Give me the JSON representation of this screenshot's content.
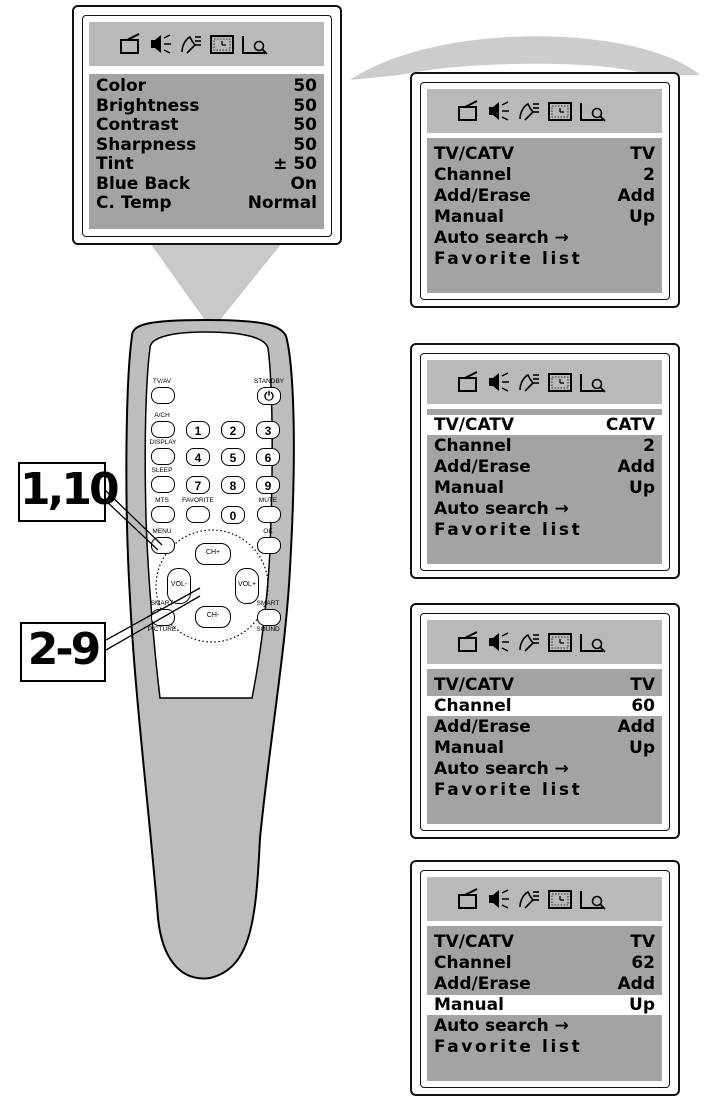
{
  "picture_menu": {
    "rows": [
      {
        "label": "Color",
        "value": "50"
      },
      {
        "label": "Brightness",
        "value": "50"
      },
      {
        "label": "Contrast",
        "value": "50"
      },
      {
        "label": "Sharpness",
        "value": "50"
      },
      {
        "label": "Tint",
        "value": "± 50"
      },
      {
        "label": "Blue Back",
        "value": "On"
      },
      {
        "label": "C. Temp",
        "value": "Normal"
      }
    ]
  },
  "channel_menus": [
    {
      "rows": [
        {
          "label": "TV/CATV",
          "value": "TV"
        },
        {
          "label": "Channel",
          "value": "2"
        },
        {
          "label": "Add/Erase",
          "value": "Add"
        },
        {
          "label": "Manual",
          "value": "Up"
        },
        {
          "label": "Auto search →",
          "value": ""
        },
        {
          "label": "Favorite list",
          "value": ""
        }
      ]
    },
    {
      "rows": [
        {
          "label": "TV/CATV",
          "value": "CATV"
        },
        {
          "label": "Channel",
          "value": "2"
        },
        {
          "label": "Add/Erase",
          "value": "Add"
        },
        {
          "label": "Manual",
          "value": "Up"
        },
        {
          "label": "Auto search →",
          "value": ""
        },
        {
          "label": "Favorite list",
          "value": ""
        }
      ]
    },
    {
      "rows": [
        {
          "label": "TV/CATV",
          "value": "TV"
        },
        {
          "label": "Channel",
          "value": "60"
        },
        {
          "label": "Add/Erase",
          "value": "Add"
        },
        {
          "label": "Manual",
          "value": "Up"
        },
        {
          "label": "Auto search →",
          "value": ""
        },
        {
          "label": "Favorite list",
          "value": ""
        }
      ]
    },
    {
      "rows": [
        {
          "label": "TV/CATV",
          "value": "TV"
        },
        {
          "label": "Channel",
          "value": "62"
        },
        {
          "label": "Add/Erase",
          "value": "Add"
        },
        {
          "label": "Manual",
          "value": "Up"
        },
        {
          "label": "Auto search →",
          "value": ""
        },
        {
          "label": "Favorite list",
          "value": ""
        }
      ]
    }
  ],
  "remote": {
    "tv_av": "TV/AV",
    "standby": "STANDBY",
    "ach": "A/CH",
    "display": "DISPLAY",
    "sleep": "SLEEP",
    "mts": "MTS",
    "favorite": "FAVORITE",
    "mute": "MUTE",
    "menu": "MENU",
    "ok": "OK",
    "ch_up": "CH+",
    "ch_down": "CH-",
    "vol_down": "VOL-",
    "vol_up": "VOL+",
    "smart1": "SMART",
    "picture": "PICTURE",
    "smart2": "SMART",
    "sound": "SOUND",
    "digits": [
      "1",
      "2",
      "3",
      "4",
      "5",
      "6",
      "7",
      "8",
      "9",
      "0"
    ]
  },
  "steps": {
    "step_a": "1,10",
    "step_b": "2-9"
  }
}
